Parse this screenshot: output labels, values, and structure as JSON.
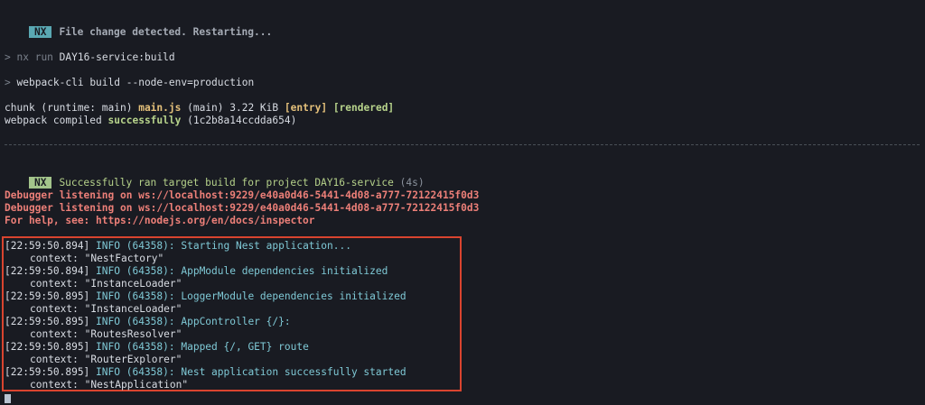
{
  "restart_notice": {
    "badge": "NX",
    "text": "File change detected. Restarting..."
  },
  "nx_command": {
    "prompt": ">",
    "cmd": "nx run",
    "target": "DAY16-service:build"
  },
  "webpack_command": {
    "prompt": ">",
    "cmd": "webpack-cli build --node-env=production"
  },
  "chunk_line": {
    "prefix": "chunk (runtime: main)",
    "file": "main.js",
    "size": "(main) 3.22 KiB",
    "entry": "[entry]",
    "rendered": "[rendered]"
  },
  "compile_line": {
    "prefix": "webpack compiled",
    "status": "successfully",
    "hash": "(1c2b8a14ccdda654)"
  },
  "success_notice": {
    "badge": "NX",
    "text": "Successfully ran target build for project DAY16-service",
    "duration": "(4s)"
  },
  "debugger_lines": [
    "Debugger listening on ws://localhost:9229/e40a0d46-5441-4d08-a777-72122415f0d3",
    "Debugger listening on ws://localhost:9229/e40a0d46-5441-4d08-a777-72122415f0d3",
    "For help, see: https://nodejs.org/en/docs/inspector"
  ],
  "log_entries": [
    {
      "time": "[22:59:50.894]",
      "level": "INFO (64358):",
      "msg": "Starting Nest application...",
      "context": "context: \"NestFactory\""
    },
    {
      "time": "[22:59:50.894]",
      "level": "INFO (64358):",
      "msg": "AppModule dependencies initialized",
      "context": "context: \"InstanceLoader\""
    },
    {
      "time": "[22:59:50.895]",
      "level": "INFO (64358):",
      "msg": "LoggerModule dependencies initialized",
      "context": "context: \"InstanceLoader\""
    },
    {
      "time": "[22:59:50.895]",
      "level": "INFO (64358):",
      "msg": "AppController {/}:",
      "context": "context: \"RoutesResolver\""
    },
    {
      "time": "[22:59:50.895]",
      "level": "INFO (64358):",
      "msg": "Mapped {/, GET} route",
      "context": "context: \"RouterExplorer\""
    },
    {
      "time": "[22:59:50.895]",
      "level": "INFO (64358):",
      "msg": "Nest application successfully started",
      "context": "context: \"NestApplication\""
    }
  ],
  "colors": {
    "background": "#191b22",
    "highlight_box": "#d9442f",
    "info": "#7fc9d6",
    "error": "#ec7f78",
    "success": "#b7d38b",
    "badge_cyan": "#5aa8b3",
    "badge_green": "#a3c48b"
  }
}
